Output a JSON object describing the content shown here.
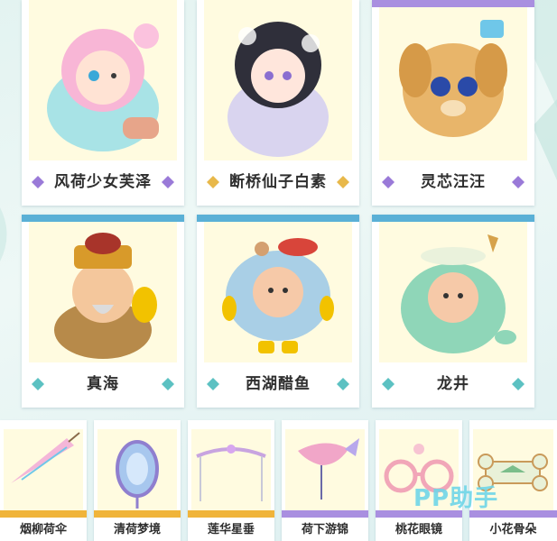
{
  "colors": {
    "background": "#e3f3f1",
    "card_panel": "#fffbe0",
    "stripe_purple": "#a98fe0",
    "stripe_blue": "#5ab0d6",
    "gem_purple": "#9a7ad8",
    "gem_gold": "#e8b84a",
    "gem_teal": "#5cc1c2",
    "ticket_bar_gold": "#f0b43a",
    "ticket_bar_purple": "#a98fe0",
    "watermark": "#6fd6e8"
  },
  "top_row": [
    {
      "name": "风荷少女芙泽",
      "gem": "gem-purple",
      "art": "pink-haired-girl-figure"
    },
    {
      "name": "断桥仙子白素",
      "gem": "gem-gold",
      "art": "dark-haired-fairy-figure"
    },
    {
      "name": "灵芯汪汪",
      "gem": "gem-purple",
      "art": "golden-puppy-figure"
    }
  ],
  "middle_row": [
    {
      "name": "真海",
      "gem": "gem-teal",
      "art": "old-man-figure"
    },
    {
      "name": "西湖醋鱼",
      "gem": "gem-teal",
      "art": "fish-costume-figure"
    },
    {
      "name": "龙井",
      "gem": "gem-teal",
      "art": "green-dragon-figure"
    }
  ],
  "bottom_row": [
    {
      "name": "烟柳荷伞",
      "bar": "gold",
      "art": "umbrella-icon"
    },
    {
      "name": "清荷梦境",
      "bar": "gold",
      "art": "mirror-icon"
    },
    {
      "name": "莲华星垂",
      "bar": "gold",
      "art": "arch-frame-icon"
    },
    {
      "name": "荷下游锦",
      "bar": "purple",
      "art": "koi-fish-icon"
    },
    {
      "name": "桃花眼镜",
      "bar": "purple",
      "art": "flower-glasses-icon"
    },
    {
      "name": "小花骨朵",
      "bar": "purple",
      "art": "bone-hat-icon"
    }
  ],
  "watermark": "PP助手"
}
